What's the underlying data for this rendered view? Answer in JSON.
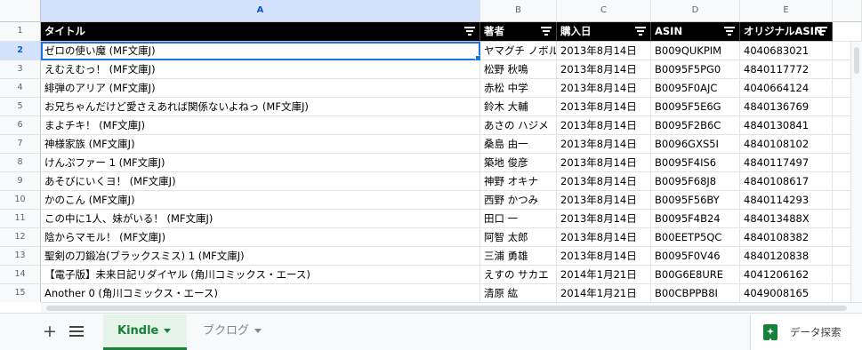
{
  "columns": [
    "A",
    "B",
    "C",
    "D",
    "E"
  ],
  "header_row_number": "1",
  "headers": [
    "タイトル",
    "著者",
    "購入日",
    "ASIN",
    "オリジナルASIN"
  ],
  "rows": [
    {
      "num": "2",
      "title": "ゼロの使い魔 (MF文庫J)",
      "author": "ヤマグチ ノボル",
      "date": "2013年8月14日",
      "asin": "B009QUKPIM",
      "orig": "4040683021"
    },
    {
      "num": "3",
      "title": "えむえむっ！ (MF文庫J)",
      "author": "松野 秋鳴",
      "date": "2013年8月14日",
      "asin": "B0095F5PG0",
      "orig": "4840117772"
    },
    {
      "num": "4",
      "title": "緋弾のアリア (MF文庫J)",
      "author": "赤松 中学",
      "date": "2013年8月14日",
      "asin": "B0095F0AJC",
      "orig": "4040664124"
    },
    {
      "num": "5",
      "title": "お兄ちゃんだけど愛さえあれば関係ないよねっ (MF文庫J)",
      "author": "鈴木 大輔",
      "date": "2013年8月14日",
      "asin": "B0095F5E6G",
      "orig": "4840136769"
    },
    {
      "num": "6",
      "title": "まよチキ！ (MF文庫J)",
      "author": "あさの ハジメ",
      "date": "2013年8月14日",
      "asin": "B0095F2B6C",
      "orig": "4840130841"
    },
    {
      "num": "7",
      "title": "神様家族 (MF文庫J)",
      "author": "桑島 由一",
      "date": "2013年8月14日",
      "asin": "B0096GXS5I",
      "orig": "4840108102"
    },
    {
      "num": "8",
      "title": "けんぷファー 1 (MF文庫J)",
      "author": "築地 俊彦",
      "date": "2013年8月14日",
      "asin": "B0095F4IS6",
      "orig": "4840117497"
    },
    {
      "num": "9",
      "title": "あそびにいくヨ！ (MF文庫J)",
      "author": "神野 オキナ",
      "date": "2013年8月14日",
      "asin": "B0095F68J8",
      "orig": "4840108617"
    },
    {
      "num": "10",
      "title": "かのこん (MF文庫J)",
      "author": "西野 かつみ",
      "date": "2013年8月14日",
      "asin": "B0095F56BY",
      "orig": "4840114293"
    },
    {
      "num": "11",
      "title": "この中に1人、妹がいる！ (MF文庫J)",
      "author": "田口 一",
      "date": "2013年8月14日",
      "asin": "B0095F4B24",
      "orig": "484013488X"
    },
    {
      "num": "12",
      "title": "陰からマモル！ (MF文庫J)",
      "author": "阿智 太郎",
      "date": "2013年8月14日",
      "asin": "B00EETP5QC",
      "orig": "4840108382"
    },
    {
      "num": "13",
      "title": "聖剣の刀鍛冶(ブラックスミス) 1 (MF文庫J)",
      "author": "三浦 勇雄",
      "date": "2013年8月14日",
      "asin": "B0095F0V46",
      "orig": "4840120838"
    },
    {
      "num": "14",
      "title": "【電子版】未来日記リダイヤル (角川コミックス・エース)",
      "author": "えすの サカエ",
      "date": "2014年1月21日",
      "asin": "B00G6E8URE",
      "orig": "4041206162"
    },
    {
      "num": "15",
      "title": "Another 0 (角川コミックス・エース)",
      "author": "清原 紘",
      "date": "2014年1月21日",
      "asin": "B00CBPPB8I",
      "orig": "4049008165"
    }
  ],
  "tabs": {
    "add_icon": "plus-icon",
    "all_sheets_icon": "menu-lines-icon",
    "active": "Kindle",
    "inactive": "ブクログ"
  },
  "explore": {
    "label": "データ探索",
    "icon": "explore-sparkle-icon",
    "color": "#188038"
  },
  "colors": {
    "header_bg": "#000000",
    "selection": "#1a73e8",
    "active_tab": "#188038"
  }
}
